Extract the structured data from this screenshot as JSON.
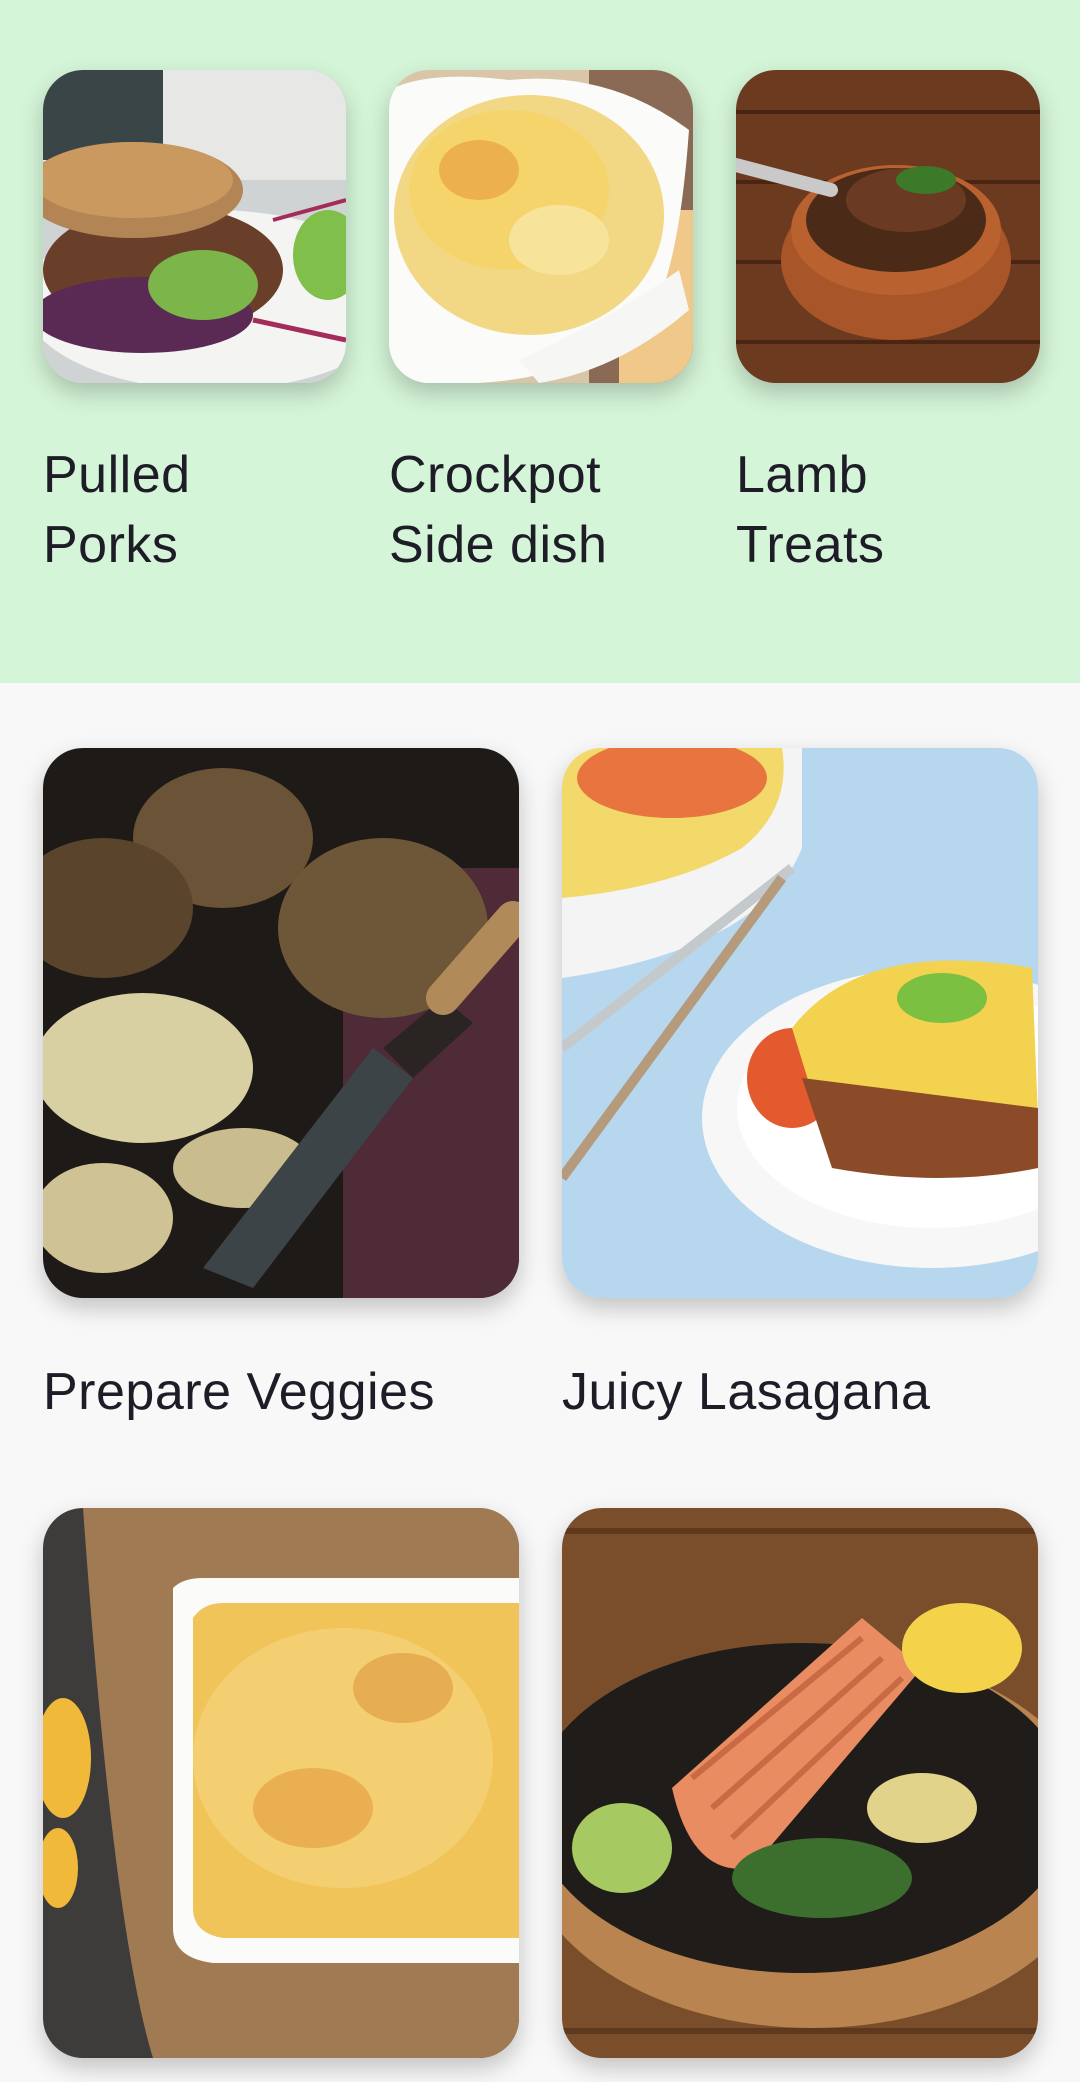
{
  "top_section": {
    "items": [
      {
        "title_lines": [
          "Pulled",
          "Porks"
        ],
        "image": "pulled-pork-sandwich-image"
      },
      {
        "title_lines": [
          "Crockpot",
          "Side dish"
        ],
        "image": "creamed-corn-image"
      },
      {
        "title_lines": [
          "Lamb",
          "Treats"
        ],
        "image": "lamb-shank-stew-image"
      }
    ]
  },
  "bottom_section": {
    "items": [
      {
        "title": "Prepare Veggies",
        "image": "potatoes-peeler-image"
      },
      {
        "title": "Juicy Lasagana",
        "image": "shepherds-pie-image"
      },
      {
        "title": "",
        "image": "mac-and-cheese-image"
      },
      {
        "title": "",
        "image": "grilled-salmon-image"
      }
    ]
  },
  "colors": {
    "top_background": "#d5f5d8",
    "page_background": "#f8f8f8",
    "text": "#1d1c27"
  }
}
